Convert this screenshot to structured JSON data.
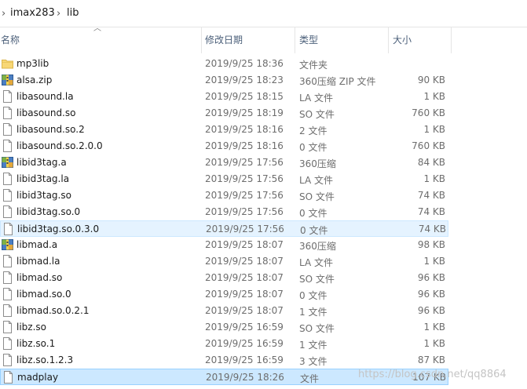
{
  "breadcrumb": {
    "sep1": "›",
    "seg1": "imax283",
    "sep2": "›",
    "seg2": "lib"
  },
  "columns": {
    "name": "名称",
    "date": "修改日期",
    "type": "类型",
    "size": "大小"
  },
  "rows": [
    {
      "icon": "folder",
      "name": "mp3lib",
      "date": "2019/9/25 18:36",
      "type": "文件夹",
      "size": ""
    },
    {
      "icon": "archive",
      "name": "alsa.zip",
      "date": "2019/9/25 18:23",
      "type": "360压缩 ZIP 文件",
      "size": "90 KB"
    },
    {
      "icon": "file",
      "name": "libasound.la",
      "date": "2019/9/25 18:15",
      "type": "LA 文件",
      "size": "1 KB"
    },
    {
      "icon": "file",
      "name": "libasound.so",
      "date": "2019/9/25 18:19",
      "type": "SO 文件",
      "size": "760 KB"
    },
    {
      "icon": "file",
      "name": "libasound.so.2",
      "date": "2019/9/25 18:16",
      "type": "2 文件",
      "size": "1 KB"
    },
    {
      "icon": "file",
      "name": "libasound.so.2.0.0",
      "date": "2019/9/25 18:16",
      "type": "0 文件",
      "size": "760 KB"
    },
    {
      "icon": "archive",
      "name": "libid3tag.a",
      "date": "2019/9/25 17:56",
      "type": "360压缩",
      "size": "84 KB"
    },
    {
      "icon": "file",
      "name": "libid3tag.la",
      "date": "2019/9/25 17:56",
      "type": "LA 文件",
      "size": "1 KB"
    },
    {
      "icon": "file",
      "name": "libid3tag.so",
      "date": "2019/9/25 17:56",
      "type": "SO 文件",
      "size": "74 KB"
    },
    {
      "icon": "file",
      "name": "libid3tag.so.0",
      "date": "2019/9/25 17:56",
      "type": "0 文件",
      "size": "74 KB"
    },
    {
      "icon": "file",
      "name": "libid3tag.so.0.3.0",
      "date": "2019/9/25 17:56",
      "type": "0 文件",
      "size": "74 KB",
      "state": "hover"
    },
    {
      "icon": "archive",
      "name": "libmad.a",
      "date": "2019/9/25 18:07",
      "type": "360压缩",
      "size": "98 KB"
    },
    {
      "icon": "file",
      "name": "libmad.la",
      "date": "2019/9/25 18:07",
      "type": "LA 文件",
      "size": "1 KB"
    },
    {
      "icon": "file",
      "name": "libmad.so",
      "date": "2019/9/25 18:07",
      "type": "SO 文件",
      "size": "96 KB"
    },
    {
      "icon": "file",
      "name": "libmad.so.0",
      "date": "2019/9/25 18:07",
      "type": "0 文件",
      "size": "96 KB"
    },
    {
      "icon": "file",
      "name": "libmad.so.0.2.1",
      "date": "2019/9/25 18:07",
      "type": "1 文件",
      "size": "96 KB"
    },
    {
      "icon": "file",
      "name": "libz.so",
      "date": "2019/9/25 16:59",
      "type": "SO 文件",
      "size": "1 KB"
    },
    {
      "icon": "file",
      "name": "libz.so.1",
      "date": "2019/9/25 16:59",
      "type": "1 文件",
      "size": "1 KB"
    },
    {
      "icon": "file",
      "name": "libz.so.1.2.3",
      "date": "2019/9/25 16:59",
      "type": "3 文件",
      "size": "87 KB"
    },
    {
      "icon": "file",
      "name": "madplay",
      "date": "2019/9/25 18:26",
      "type": "文件",
      "size": "107 KB",
      "state": "selected"
    }
  ],
  "watermark": "https://blog.csdn.net/qq8864",
  "colors": {
    "hover_bg": "#e5f3ff",
    "selected_bg": "#cce8ff",
    "header_text": "#4c607a",
    "folder": "#f8d775"
  }
}
